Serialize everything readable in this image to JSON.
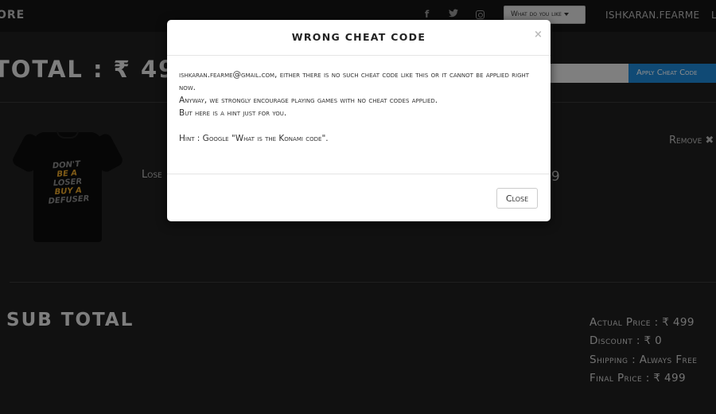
{
  "navbar": {
    "brand_text": "ORE",
    "social_icons": [
      "facebook-icon",
      "twitter-icon",
      "instagram-icon"
    ],
    "facebook_glyph": "f",
    "twitter_glyph": "🐦",
    "dropdown_label": "What do you like",
    "username": "ISHKARAN.FEARME",
    "extra": "L"
  },
  "cart": {
    "total_title": "TOTAL : ₹ 499",
    "cheat_input_value": "",
    "cheat_button_label": "Apply Cheat Code",
    "item": {
      "name": "Lose",
      "price": "99",
      "remove_label": "Remove ✖",
      "shirt_text": [
        "DON'T",
        "BE A",
        "LOSER",
        "BUY A",
        "DEFUSER"
      ]
    },
    "subtotal": {
      "title": "SUB TOTAL",
      "actual_price": "Actual Price : ₹ 499",
      "discount": "Discount : ₹ 0",
      "shipping": "Shipping : Always Free",
      "final_price": "Final Price : ₹ 499"
    }
  },
  "modal": {
    "title": "WRONG CHEAT CODE",
    "close_glyph": "×",
    "message_line1": "ishkaran.fearme@gmail.com, either there is no such cheat code like this or it cannot be applied right now.",
    "message_line2": "Anyway, we strongly encourage playing games with no cheat codes applied.",
    "message_line3": "But here is a hint just for you.",
    "hint": "Hint : Google \"What is the Konami code\".",
    "close_button_label": "Close"
  },
  "colors": {
    "page_bg": "#1f1f1f",
    "navbar_bg": "#141414",
    "accent_button": "#1e88d6",
    "shirt_accent": "#e5a42a"
  }
}
